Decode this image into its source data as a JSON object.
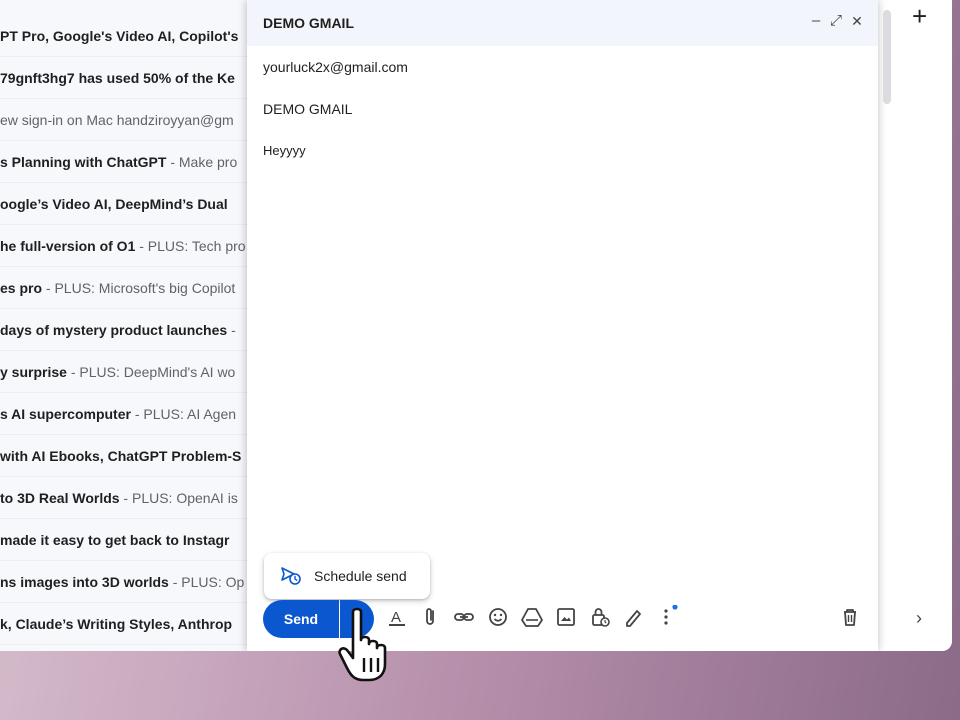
{
  "inbox": {
    "rows": [
      {
        "subject": "PT Pro, Google's Video AI, Copilot's",
        "snippet": "",
        "read": false
      },
      {
        "subject": "79gnft3hg7 has used 50% of the Ke",
        "snippet": "",
        "read": false
      },
      {
        "subject": "ew sign-in on Mac handziroyyan@gm",
        "snippet": "",
        "read": true
      },
      {
        "subject": "s Planning with ChatGPT",
        "snippet": " - Make pro",
        "read": false
      },
      {
        "subject": "oogle’s Video AI, DeepMind’s Dual",
        "snippet": "",
        "read": false
      },
      {
        "subject": "he full-version of O1",
        "snippet": " - PLUS: Tech pro",
        "read": false
      },
      {
        "subject": "es pro",
        "snippet": " - PLUS: Microsoft's big Copilot",
        "read": false
      },
      {
        "subject": "days of mystery product launches",
        "snippet": " -",
        "read": false
      },
      {
        "subject": "y surprise",
        "snippet": " - PLUS: DeepMind's AI wo",
        "read": false
      },
      {
        "subject": "s AI supercomputer",
        "snippet": " - PLUS: AI Agen",
        "read": false
      },
      {
        "subject": "with AI Ebooks, ChatGPT Problem-S",
        "snippet": "",
        "read": false
      },
      {
        "subject": "to 3D Real Worlds",
        "snippet": " - PLUS: OpenAI is",
        "read": false
      },
      {
        "subject": "made it easy to get back to Instagr",
        "snippet": "",
        "read": false
      },
      {
        "subject": "ns images into 3D worlds",
        "snippet": " - PLUS: Op",
        "read": false
      },
      {
        "subject": "k, Claude’s Writing Styles, Anthrop",
        "snippet": "",
        "read": false
      }
    ]
  },
  "rail": {
    "add_label": "+",
    "chevron_label": "›"
  },
  "compose": {
    "title": "DEMO GMAIL",
    "minimize": "–",
    "expand": "⤢",
    "close": "✕",
    "to": "yourluck2x@gmail.com",
    "subject": "DEMO GMAIL",
    "body": "Heyyyy",
    "schedule_send": "Schedule send",
    "send": "Send",
    "send_options_arrow": "▲"
  },
  "colors": {
    "send_blue": "#0b57d0",
    "header_bg": "#f2f6fc",
    "notify_dot": "#1a73e8"
  },
  "icons": [
    "text-format-icon",
    "attach-icon",
    "link-icon",
    "emoji-icon",
    "drive-icon",
    "photo-icon",
    "confidential-lock-icon",
    "signature-icon",
    "more-options-icon",
    "trash-icon",
    "schedule-send-icon"
  ]
}
